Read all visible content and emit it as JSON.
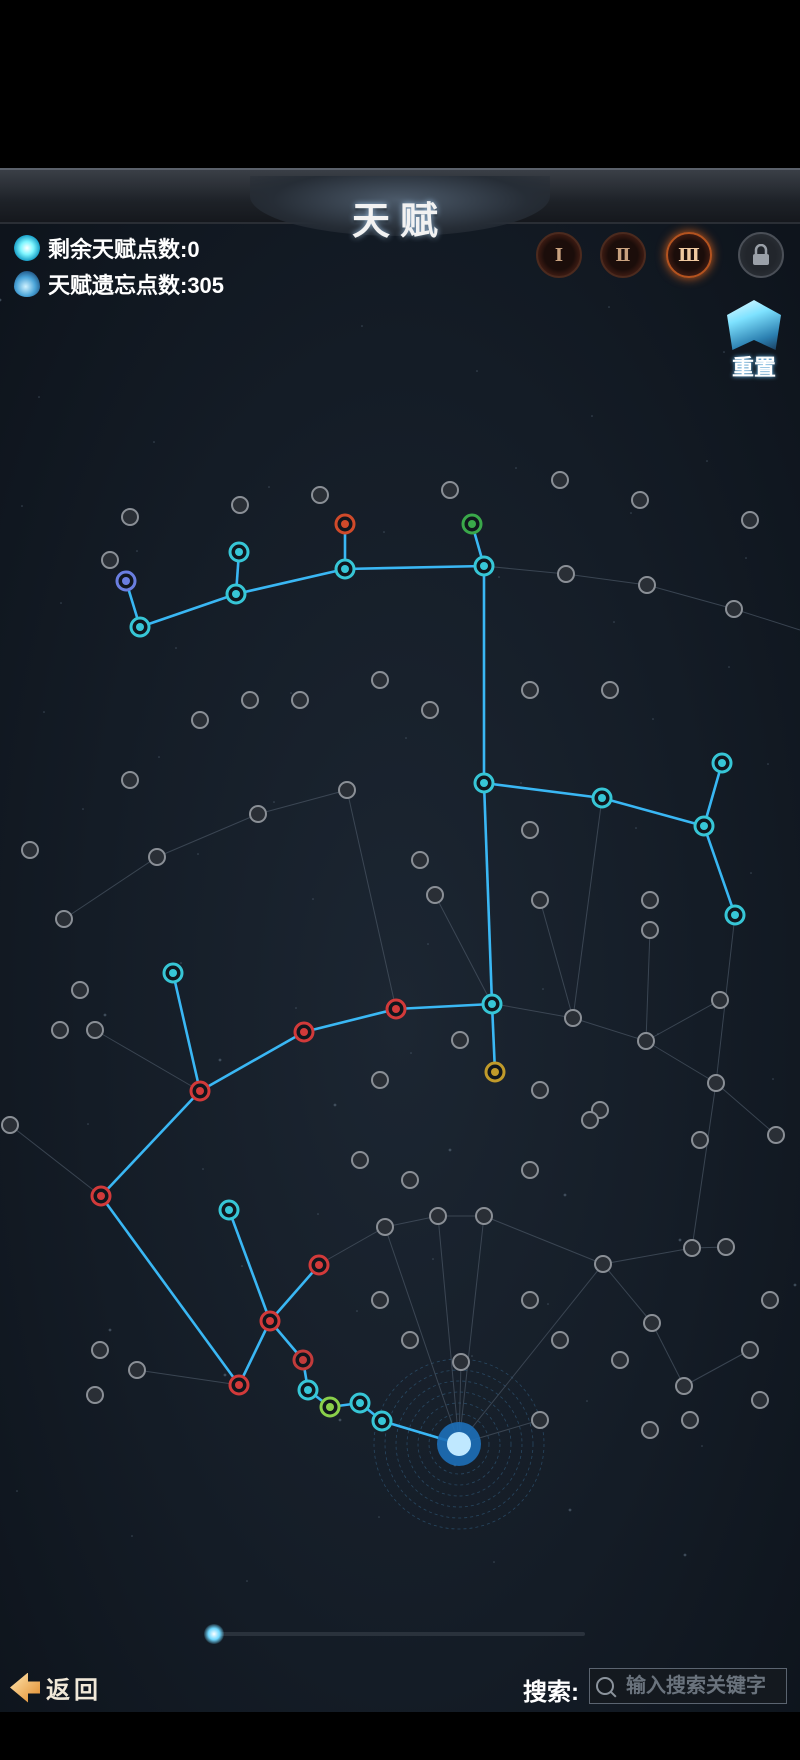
{
  "header": {
    "title": "天赋"
  },
  "stats": {
    "remaining_points": "剩余天赋点数:0",
    "forget_points": "天赋遗忘点数:305"
  },
  "pages": [
    {
      "label": "Ⅰ",
      "state": "normal"
    },
    {
      "label": "Ⅱ",
      "state": "normal"
    },
    {
      "label": "Ⅲ",
      "state": "active"
    },
    {
      "label": "",
      "icon": "lock-icon",
      "state": "locked"
    }
  ],
  "reset": {
    "label": "重置"
  },
  "footer": {
    "back_label": "返回",
    "search_label": "搜索:",
    "search_placeholder": "输入搜索关键字",
    "search_value": ""
  },
  "colors": {
    "active_line": "#3cc0ff",
    "inactive_line": "#4a5664",
    "node_teal": "#37c6d6",
    "node_red": "#d23a3a",
    "node_gray": "#8a8f96",
    "accent_orange": "#d0601f"
  }
}
